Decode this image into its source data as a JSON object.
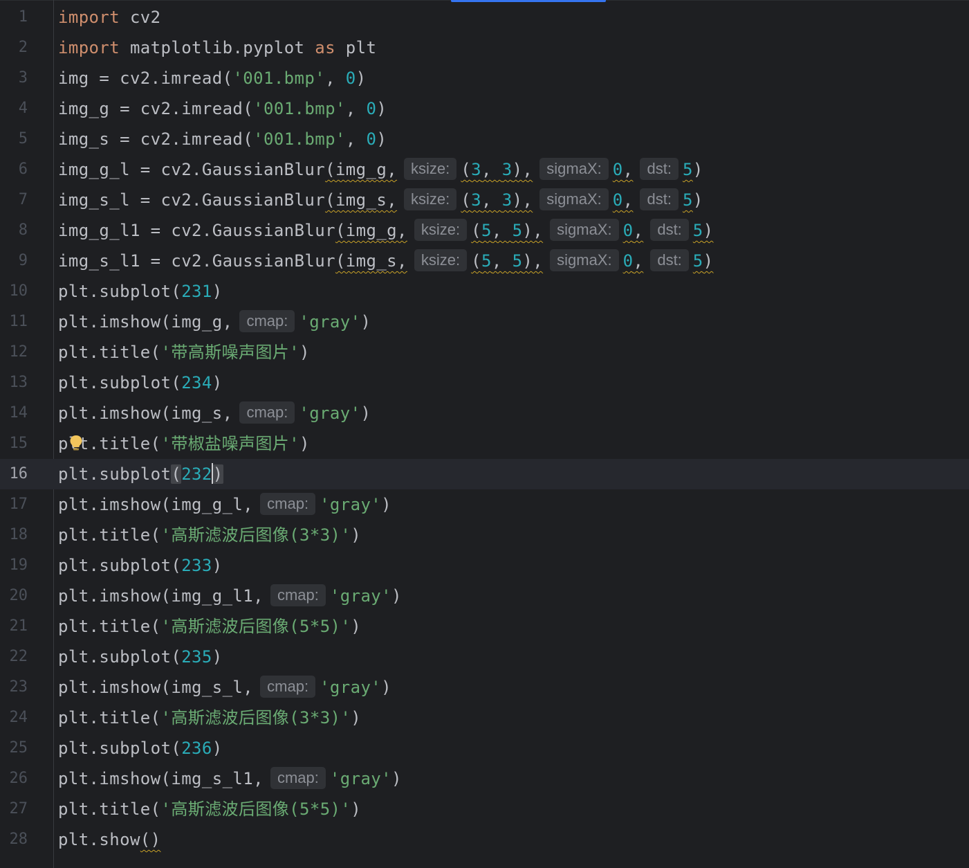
{
  "editor": {
    "current_line": 16,
    "lines": [
      {
        "n": "1",
        "tokens": [
          {
            "t": "import",
            "c": "kw"
          },
          {
            "t": " cv2",
            "c": "id"
          }
        ]
      },
      {
        "n": "2",
        "tokens": [
          {
            "t": "import",
            "c": "kw"
          },
          {
            "t": " matplotlib.pyplot ",
            "c": "id"
          },
          {
            "t": "as",
            "c": "kw"
          },
          {
            "t": " plt",
            "c": "id"
          }
        ]
      },
      {
        "n": "3",
        "tokens": [
          {
            "t": "img = cv2.imread(",
            "c": "id"
          },
          {
            "t": "'001.bmp'",
            "c": "str"
          },
          {
            "t": ", ",
            "c": "punc"
          },
          {
            "t": "0",
            "c": "num"
          },
          {
            "t": ")",
            "c": "punc"
          }
        ]
      },
      {
        "n": "4",
        "tokens": [
          {
            "t": "img_g = cv2.imread(",
            "c": "id"
          },
          {
            "t": "'001.bmp'",
            "c": "str"
          },
          {
            "t": ", ",
            "c": "punc"
          },
          {
            "t": "0",
            "c": "num"
          },
          {
            "t": ")",
            "c": "punc"
          }
        ]
      },
      {
        "n": "5",
        "tokens": [
          {
            "t": "img_s = cv2.imread(",
            "c": "id"
          },
          {
            "t": "'001.bmp'",
            "c": "str"
          },
          {
            "t": ", ",
            "c": "punc"
          },
          {
            "t": "0",
            "c": "num"
          },
          {
            "t": ")",
            "c": "punc"
          }
        ]
      },
      {
        "n": "6",
        "tokens": [
          {
            "t": "img_g_l = cv2.GaussianBlur",
            "c": "id"
          },
          {
            "t": "(img_g,",
            "c": "id",
            "s": true
          },
          {
            "hint": "ksize:"
          },
          {
            "t": "(",
            "c": "punc",
            "s": true
          },
          {
            "t": "3",
            "c": "num",
            "s": true
          },
          {
            "t": ", ",
            "c": "punc",
            "s": true
          },
          {
            "t": "3",
            "c": "num",
            "s": true
          },
          {
            "t": "),",
            "c": "punc",
            "s": true
          },
          {
            "hint": "sigmaX:"
          },
          {
            "t": "0",
            "c": "num",
            "s": true
          },
          {
            "t": ",",
            "c": "punc",
            "s": true
          },
          {
            "hint": "dst:"
          },
          {
            "t": "5",
            "c": "num",
            "s": true
          },
          {
            "t": ")",
            "c": "punc"
          }
        ]
      },
      {
        "n": "7",
        "tokens": [
          {
            "t": "img_s_l = cv2.GaussianBlur",
            "c": "id"
          },
          {
            "t": "(img_s,",
            "c": "id",
            "s": true
          },
          {
            "hint": "ksize:"
          },
          {
            "t": "(",
            "c": "punc",
            "s": true
          },
          {
            "t": "3",
            "c": "num",
            "s": true
          },
          {
            "t": ", ",
            "c": "punc",
            "s": true
          },
          {
            "t": "3",
            "c": "num",
            "s": true
          },
          {
            "t": "),",
            "c": "punc",
            "s": true
          },
          {
            "hint": "sigmaX:"
          },
          {
            "t": "0",
            "c": "num",
            "s": true
          },
          {
            "t": ",",
            "c": "punc",
            "s": true
          },
          {
            "hint": "dst:"
          },
          {
            "t": "5",
            "c": "num",
            "s": true
          },
          {
            "t": ")",
            "c": "punc"
          }
        ]
      },
      {
        "n": "8",
        "tokens": [
          {
            "t": "img_g_l1 = cv2.GaussianBlur",
            "c": "id"
          },
          {
            "t": "(img_g,",
            "c": "id",
            "s": true
          },
          {
            "hint": "ksize:"
          },
          {
            "t": "(",
            "c": "punc",
            "s": true
          },
          {
            "t": "5",
            "c": "num",
            "s": true
          },
          {
            "t": ", ",
            "c": "punc",
            "s": true
          },
          {
            "t": "5",
            "c": "num",
            "s": true
          },
          {
            "t": "),",
            "c": "punc",
            "s": true
          },
          {
            "hint": "sigmaX:"
          },
          {
            "t": "0",
            "c": "num",
            "s": true
          },
          {
            "t": ",",
            "c": "punc",
            "s": true
          },
          {
            "hint": "dst:"
          },
          {
            "t": "5",
            "c": "num",
            "s": true
          },
          {
            "t": ")",
            "c": "punc",
            "s": true
          }
        ]
      },
      {
        "n": "9",
        "tokens": [
          {
            "t": "img_s_l1 = cv2.GaussianBlur",
            "c": "id"
          },
          {
            "t": "(img_s,",
            "c": "id",
            "s": true
          },
          {
            "hint": "ksize:"
          },
          {
            "t": "(",
            "c": "punc",
            "s": true
          },
          {
            "t": "5",
            "c": "num",
            "s": true
          },
          {
            "t": ", ",
            "c": "punc",
            "s": true
          },
          {
            "t": "5",
            "c": "num",
            "s": true
          },
          {
            "t": "),",
            "c": "punc",
            "s": true
          },
          {
            "hint": "sigmaX:"
          },
          {
            "t": "0",
            "c": "num",
            "s": true
          },
          {
            "t": ",",
            "c": "punc",
            "s": true
          },
          {
            "hint": "dst:"
          },
          {
            "t": "5",
            "c": "num",
            "s": true
          },
          {
            "t": ")",
            "c": "punc",
            "s": true
          }
        ]
      },
      {
        "n": "10",
        "tokens": [
          {
            "t": "plt.subplot(",
            "c": "id"
          },
          {
            "t": "231",
            "c": "num"
          },
          {
            "t": ")",
            "c": "punc"
          }
        ]
      },
      {
        "n": "11",
        "tokens": [
          {
            "t": "plt.imshow(img_g,",
            "c": "id"
          },
          {
            "hint": "cmap:"
          },
          {
            "t": "'gray'",
            "c": "str"
          },
          {
            "t": ")",
            "c": "punc"
          }
        ]
      },
      {
        "n": "12",
        "tokens": [
          {
            "t": "plt.title(",
            "c": "id"
          },
          {
            "t": "'带高斯噪声图片'",
            "c": "str"
          },
          {
            "t": ")",
            "c": "punc"
          }
        ]
      },
      {
        "n": "13",
        "tokens": [
          {
            "t": "plt.subplot(",
            "c": "id"
          },
          {
            "t": "234",
            "c": "num"
          },
          {
            "t": ")",
            "c": "punc"
          }
        ]
      },
      {
        "n": "14",
        "tokens": [
          {
            "t": "plt.imshow(img_s,",
            "c": "id"
          },
          {
            "hint": "cmap:"
          },
          {
            "t": "'gray'",
            "c": "str"
          },
          {
            "t": ")",
            "c": "punc"
          }
        ]
      },
      {
        "n": "15",
        "bulb": true,
        "tokens": [
          {
            "t": "plt.title(",
            "c": "id"
          },
          {
            "t": "'带椒盐噪声图片'",
            "c": "str"
          },
          {
            "t": ")",
            "c": "punc"
          }
        ]
      },
      {
        "n": "16",
        "tokens": [
          {
            "t": "plt.subplot",
            "c": "id"
          },
          {
            "t": "(",
            "c": "punc",
            "m": true
          },
          {
            "t": "232",
            "c": "num"
          },
          {
            "caret": true
          },
          {
            "t": ")",
            "c": "punc",
            "m": true
          }
        ]
      },
      {
        "n": "17",
        "tokens": [
          {
            "t": "plt.imshow(img_g_l,",
            "c": "id"
          },
          {
            "hint": "cmap:"
          },
          {
            "t": "'gray'",
            "c": "str"
          },
          {
            "t": ")",
            "c": "punc"
          }
        ]
      },
      {
        "n": "18",
        "tokens": [
          {
            "t": "plt.title(",
            "c": "id"
          },
          {
            "t": "'高斯滤波后图像(3*3)'",
            "c": "str"
          },
          {
            "t": ")",
            "c": "punc"
          }
        ]
      },
      {
        "n": "19",
        "tokens": [
          {
            "t": "plt.subplot(",
            "c": "id"
          },
          {
            "t": "233",
            "c": "num"
          },
          {
            "t": ")",
            "c": "punc"
          }
        ]
      },
      {
        "n": "20",
        "tokens": [
          {
            "t": "plt.imshow(img_g_l1,",
            "c": "id"
          },
          {
            "hint": "cmap:"
          },
          {
            "t": "'gray'",
            "c": "str"
          },
          {
            "t": ")",
            "c": "punc"
          }
        ]
      },
      {
        "n": "21",
        "tokens": [
          {
            "t": "plt.title(",
            "c": "id"
          },
          {
            "t": "'高斯滤波后图像(5*5)'",
            "c": "str"
          },
          {
            "t": ")",
            "c": "punc"
          }
        ]
      },
      {
        "n": "22",
        "tokens": [
          {
            "t": "plt.subplot(",
            "c": "id"
          },
          {
            "t": "235",
            "c": "num"
          },
          {
            "t": ")",
            "c": "punc"
          }
        ]
      },
      {
        "n": "23",
        "tokens": [
          {
            "t": "plt.imshow(img_s_l,",
            "c": "id"
          },
          {
            "hint": "cmap:"
          },
          {
            "t": "'gray'",
            "c": "str"
          },
          {
            "t": ")",
            "c": "punc"
          }
        ]
      },
      {
        "n": "24",
        "tokens": [
          {
            "t": "plt.title(",
            "c": "id"
          },
          {
            "t": "'高斯滤波后图像(3*3)'",
            "c": "str"
          },
          {
            "t": ")",
            "c": "punc"
          }
        ]
      },
      {
        "n": "25",
        "tokens": [
          {
            "t": "plt.subplot(",
            "c": "id"
          },
          {
            "t": "236",
            "c": "num"
          },
          {
            "t": ")",
            "c": "punc"
          }
        ]
      },
      {
        "n": "26",
        "tokens": [
          {
            "t": "plt.imshow(img_s_l1,",
            "c": "id"
          },
          {
            "hint": "cmap:"
          },
          {
            "t": "'gray'",
            "c": "str"
          },
          {
            "t": ")",
            "c": "punc"
          }
        ]
      },
      {
        "n": "27",
        "tokens": [
          {
            "t": "plt.title(",
            "c": "id"
          },
          {
            "t": "'高斯滤波后图像(5*5)'",
            "c": "str"
          },
          {
            "t": ")",
            "c": "punc"
          }
        ]
      },
      {
        "n": "28",
        "tokens": [
          {
            "t": "plt.show",
            "c": "id"
          },
          {
            "t": "()",
            "c": "punc",
            "s": true
          }
        ]
      }
    ]
  },
  "theme": {
    "background": "#1e1f22",
    "keyword": "#cf8e6d",
    "string": "#6aab73",
    "number": "#2aacb8",
    "text": "#bcbec4",
    "hint_bg": "#303236",
    "hint_text": "#8c8f96",
    "warning_squiggle": "#c9a227",
    "tab_accent": "#3574f0",
    "bulb": "#f2c55c"
  },
  "icons": {
    "bulb": "lightbulb-icon"
  }
}
